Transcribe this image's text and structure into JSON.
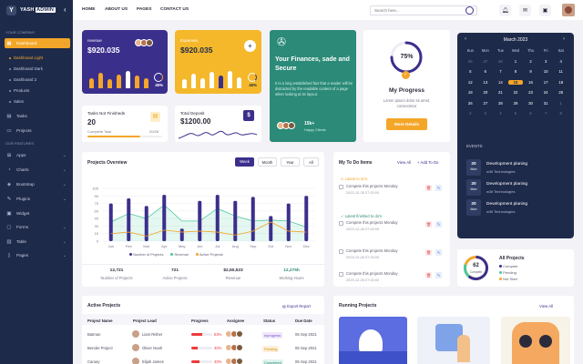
{
  "app": {
    "name": "YASH",
    "badge": "ADMIN"
  },
  "sidebar": {
    "section1": "YOUR COMPANY",
    "dashboard": "Dashboard",
    "sub": [
      "Dashboard Light",
      "Dashboard Dark",
      "Dashboard 2",
      "Products",
      "Sales"
    ],
    "tasks": "Tasks",
    "projects": "Projects",
    "section2": "OUR FEATURES",
    "features": [
      "Apps",
      "Charts",
      "Bootstrap",
      "Plugins",
      "Widget",
      "Forms",
      "Table",
      "Pages"
    ]
  },
  "topbar": {
    "links": [
      "HOME",
      "ABOUT US",
      "PAGES",
      "CONTACT US"
    ],
    "search_placeholder": "Search here..."
  },
  "kpis": {
    "revenue": {
      "label": "revenue",
      "value": "$920.035",
      "pct": "45%",
      "color": "#3b2f8c",
      "bars": [
        0.55,
        0.85,
        0.5,
        0.75,
        0.95,
        0.7,
        0.55
      ]
    },
    "expenses": {
      "label": "Expenses",
      "value": "$920.035",
      "pct": "45%",
      "color": "#f4b82a",
      "bars": [
        0.5,
        0.8,
        0.55,
        0.9,
        0.7,
        0.95,
        0.6
      ]
    },
    "tasks": {
      "label": "Tasks Not Finisheds",
      "value": "20",
      "sub": "Complete Task",
      "count": "20/28",
      "progress": 0.71
    },
    "deposit": {
      "label": "Total Deposit",
      "value": "$1200.00"
    }
  },
  "promo": {
    "title": "Your Finances, sade and Secure",
    "text": "It is a long established fact that a reader will be distracted by the readable content of a page when looking at its layout.",
    "clients_count": "15k+",
    "clients_label": "Happy Clients"
  },
  "progress_card": {
    "percent": "75%",
    "title": "My Progress",
    "text": "Lorem ipsum dolor sit amet, consectetur",
    "button": "More Details",
    "value": 0.75
  },
  "calendar": {
    "month": "March 2023",
    "weekdays": [
      "Sun",
      "Mon",
      "Tue",
      "Wed",
      "Thu",
      "Fri",
      "Sat"
    ],
    "days": [
      [
        "26",
        "m"
      ],
      [
        "27",
        "m"
      ],
      [
        "28",
        "m"
      ],
      [
        "1",
        ""
      ],
      [
        "2",
        ""
      ],
      [
        "3",
        ""
      ],
      [
        "4",
        ""
      ],
      [
        "5",
        ""
      ],
      [
        "6",
        ""
      ],
      [
        "7",
        ""
      ],
      [
        "8",
        ""
      ],
      [
        "9",
        ""
      ],
      [
        "10",
        ""
      ],
      [
        "11",
        ""
      ],
      [
        "12",
        ""
      ],
      [
        "13",
        ""
      ],
      [
        "14",
        ""
      ],
      [
        "15",
        "t"
      ],
      [
        "16",
        ""
      ],
      [
        "17",
        ""
      ],
      [
        "18",
        ""
      ],
      [
        "19",
        ""
      ],
      [
        "20",
        ""
      ],
      [
        "21",
        ""
      ],
      [
        "22",
        ""
      ],
      [
        "23",
        ""
      ],
      [
        "24",
        ""
      ],
      [
        "25",
        ""
      ],
      [
        "26",
        ""
      ],
      [
        "27",
        ""
      ],
      [
        "28",
        ""
      ],
      [
        "29",
        ""
      ],
      [
        "30",
        ""
      ],
      [
        "31",
        ""
      ],
      [
        "1",
        "m"
      ],
      [
        "2",
        "m"
      ],
      [
        "3",
        "m"
      ],
      [
        "4",
        "m"
      ],
      [
        "5",
        "m"
      ],
      [
        "6",
        "m"
      ],
      [
        "7",
        "m"
      ],
      [
        "8",
        "m"
      ]
    ],
    "events_label": "EVENTS",
    "events": [
      {
        "day": "20",
        "month": "Mon",
        "title": "Development planing",
        "sub": "w3it Technologies"
      },
      {
        "day": "20",
        "month": "Mon",
        "title": "Development planing",
        "sub": "w3it Technologies"
      },
      {
        "day": "20",
        "month": "Mon",
        "title": "Development planing",
        "sub": "w3it Technologies"
      }
    ]
  },
  "overview": {
    "title": "Projects Overview",
    "tabs": [
      "Week",
      "Month",
      "Year",
      "All"
    ],
    "legend": [
      "Number of Projects",
      "Revenue",
      "Active Projects"
    ],
    "stats": [
      {
        "value": "12,721",
        "label": "Number of Projects"
      },
      {
        "value": "721",
        "label": "Active Projects"
      },
      {
        "value": "$2,50,523",
        "label": "Revenue"
      },
      {
        "value": "12,275h",
        "label": "Working Hours"
      }
    ]
  },
  "chart_data": {
    "type": "bar",
    "categories": [
      "Jan",
      "Feb",
      "Mar",
      "Apr",
      "May",
      "Jun",
      "Jul",
      "Aug",
      "Sep",
      "Oct",
      "Nov",
      "Dec"
    ],
    "series": [
      {
        "name": "Number of Projects",
        "type": "bar",
        "values": [
          75,
          85,
          70,
          92,
          25,
          80,
          92,
          80,
          88,
          50,
          75,
          90
        ]
      },
      {
        "name": "Revenue",
        "type": "area",
        "values": [
          38,
          55,
          45,
          72,
          40,
          40,
          65,
          50,
          40,
          42,
          40,
          28
        ]
      },
      {
        "name": "Active Projects",
        "type": "line",
        "values": [
          15,
          18,
          10,
          22,
          18,
          20,
          18,
          12,
          20,
          38,
          20,
          18
        ]
      }
    ],
    "yticks": [
      0,
      15,
      30,
      45,
      60,
      75,
      90,
      105
    ],
    "ylim": [
      0,
      105
    ],
    "colors": {
      "bar": "#3b2f8c",
      "area": "#4cc79a",
      "line": "#f4a629"
    }
  },
  "todo": {
    "title": "My To Do Items",
    "view_all": "View All",
    "add": "+ Add To Do",
    "latest_todo": "Latest to do's",
    "latest_finished": "Latest finished to do's",
    "items": [
      {
        "text": "Compete this projects Monday",
        "date": "2023-12-26 07:15:00"
      },
      {
        "text": "Compete this projects Monday",
        "date": "2023-12-26 07:15:00"
      },
      {
        "text": "Compete this projects Monday",
        "date": "2023-12-26 07:15:00"
      },
      {
        "text": "Compete this projects Monday",
        "date": "2023-12-26 07:15:00"
      },
      {
        "text": "Compete this projects Monday",
        "date": "2023-12-26 07:15:00"
      }
    ]
  },
  "all_projects": {
    "title": "All Projects",
    "count": "62",
    "count_label": "Compete",
    "legend": [
      "Compete",
      "Pending",
      "Not Start"
    ]
  },
  "active_projects": {
    "title": "Active Projects",
    "export": "Export Report",
    "columns": [
      "Project Name",
      "Project Lead",
      "Progress",
      "Assignee",
      "Status",
      "Due Date"
    ],
    "rows": [
      {
        "name": "Batman",
        "lead": "Liam Risher",
        "progress": "53%",
        "pval": 0.53,
        "status": "Inprogress",
        "due": "06 Sep 2021"
      },
      {
        "name": "Bender Project",
        "lead": "Oliver Noah",
        "progress": "30%",
        "pval": 0.3,
        "status": "Pending",
        "due": "06 Sep 2021"
      },
      {
        "name": "Canary",
        "lead": "Elijah James",
        "progress": "40%",
        "pval": 0.4,
        "status": "Completed",
        "due": "06 Sep 2021"
      }
    ]
  },
  "running_projects": {
    "title": "Running Projects",
    "view_all": "View All"
  }
}
